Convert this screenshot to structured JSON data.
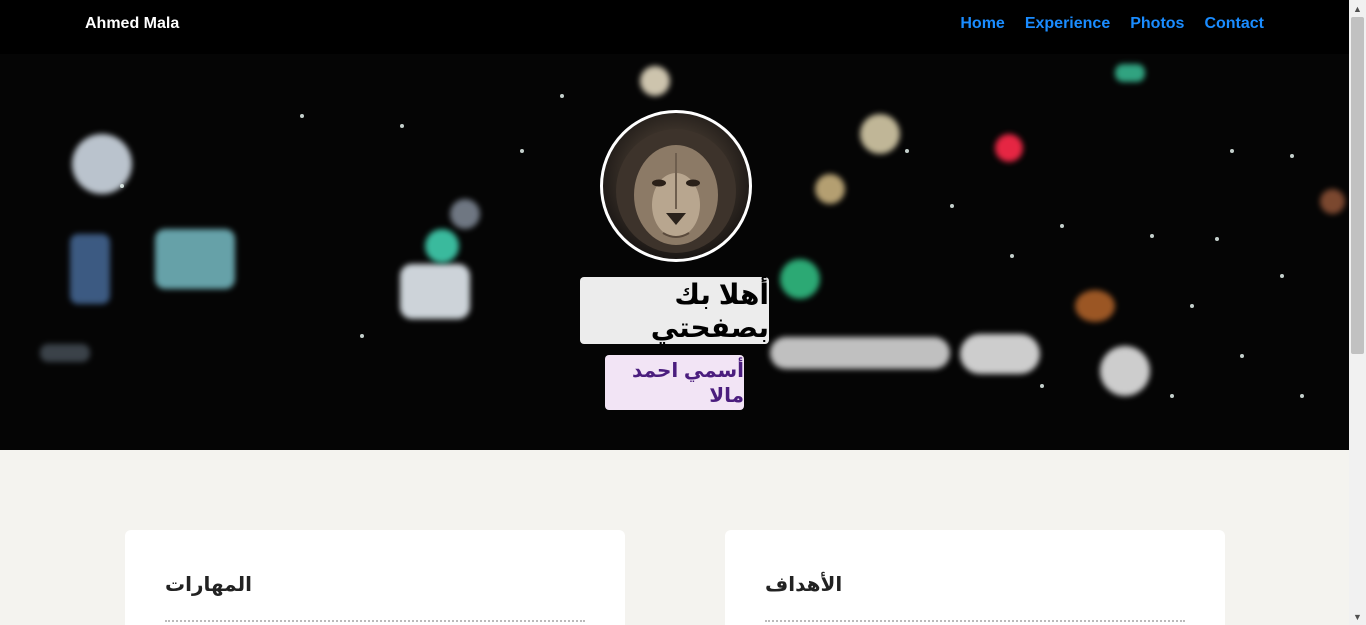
{
  "navbar": {
    "brand": "Ahmed Mala",
    "links": [
      "Home",
      "Experience",
      "Photos",
      "Contact"
    ],
    "link_color": "#1a8cff",
    "background": "#000000"
  },
  "hero": {
    "avatar_icon": "lion-portrait",
    "welcome": "أهلا بك بصفحتي",
    "name": "أسمي احمد مالا",
    "name_color": "#4b1d7e",
    "name_bg": "#f2e4f5"
  },
  "cards": [
    {
      "title": "المهارات"
    },
    {
      "title": "الأهداف"
    }
  ],
  "page_background": "#f4f3ef"
}
